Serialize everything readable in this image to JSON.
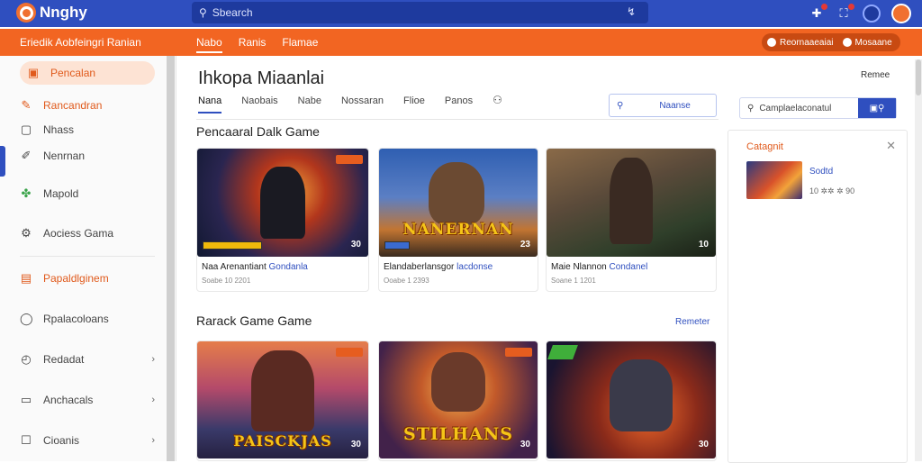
{
  "topbar": {
    "app_name": "Nnghy",
    "search_placeholder": "Sbearch"
  },
  "orangebar": {
    "title": "Eriedik Aobfeingri Ranian",
    "nav": [
      "Nabo",
      "Ranis",
      "Flamae"
    ],
    "pill_left": "Reornaaeaiai",
    "pill_right": "Mosaane"
  },
  "sidebar": {
    "items": [
      {
        "label": "Pencalan",
        "icon": "gamepad-icon"
      },
      {
        "label": "Rancandran",
        "icon": "hammer-icon"
      },
      {
        "label": "Nhass",
        "icon": "square-icon"
      },
      {
        "label": "Nenrnan",
        "icon": "pencil-icon"
      },
      {
        "label": "Mapold",
        "icon": "puzzle-icon"
      },
      {
        "label": "Aociess Gama",
        "icon": "settings-icon"
      },
      {
        "label": "Papaldlginem",
        "icon": "folder-icon"
      },
      {
        "label": "Rpalacoloans",
        "icon": "location-icon"
      },
      {
        "label": "Redadat",
        "icon": "clock-icon"
      },
      {
        "label": "Anchacals",
        "icon": "calendar-icon"
      },
      {
        "label": "Cioanis",
        "icon": "chat-icon"
      }
    ]
  },
  "main": {
    "title": "Ihkopa Miaanlai",
    "tabs": [
      "Nana",
      "Naobais",
      "Nabe",
      "Nossaran",
      "Flioe",
      "Panos"
    ],
    "search_text": "Naanse",
    "section1": {
      "title": "Pencaaral Dalk Game",
      "cards": [
        {
          "title": "Naa Arenantiant ",
          "title_link": "Gondanla",
          "sub": "Soabe 10 2201",
          "num": "30",
          "logo": ""
        },
        {
          "title": "Elandaberlansgor ",
          "title_link": "lacdonse",
          "sub": "Ooabe 1 2393",
          "num": "23",
          "logo": "NANERNAN"
        },
        {
          "title": "Maie Nlannon ",
          "title_link": "Condanel",
          "sub": "Soane 1 1201",
          "num": "10",
          "logo": ""
        }
      ]
    },
    "section2": {
      "title": "Rarack Game Game",
      "more": "Remeter",
      "cards": [
        {
          "num": "30",
          "logo": "PAISCKJAS"
        },
        {
          "num": "30",
          "logo": "STILHANS"
        },
        {
          "num": "30",
          "logo": ""
        }
      ]
    }
  },
  "right": {
    "more": "Remee",
    "search_text": "Camplaelaconatul",
    "panel_title": "Catagnit",
    "item_name": "Sodtd",
    "item_meta": "10 ✲✲ ✲ 90"
  }
}
